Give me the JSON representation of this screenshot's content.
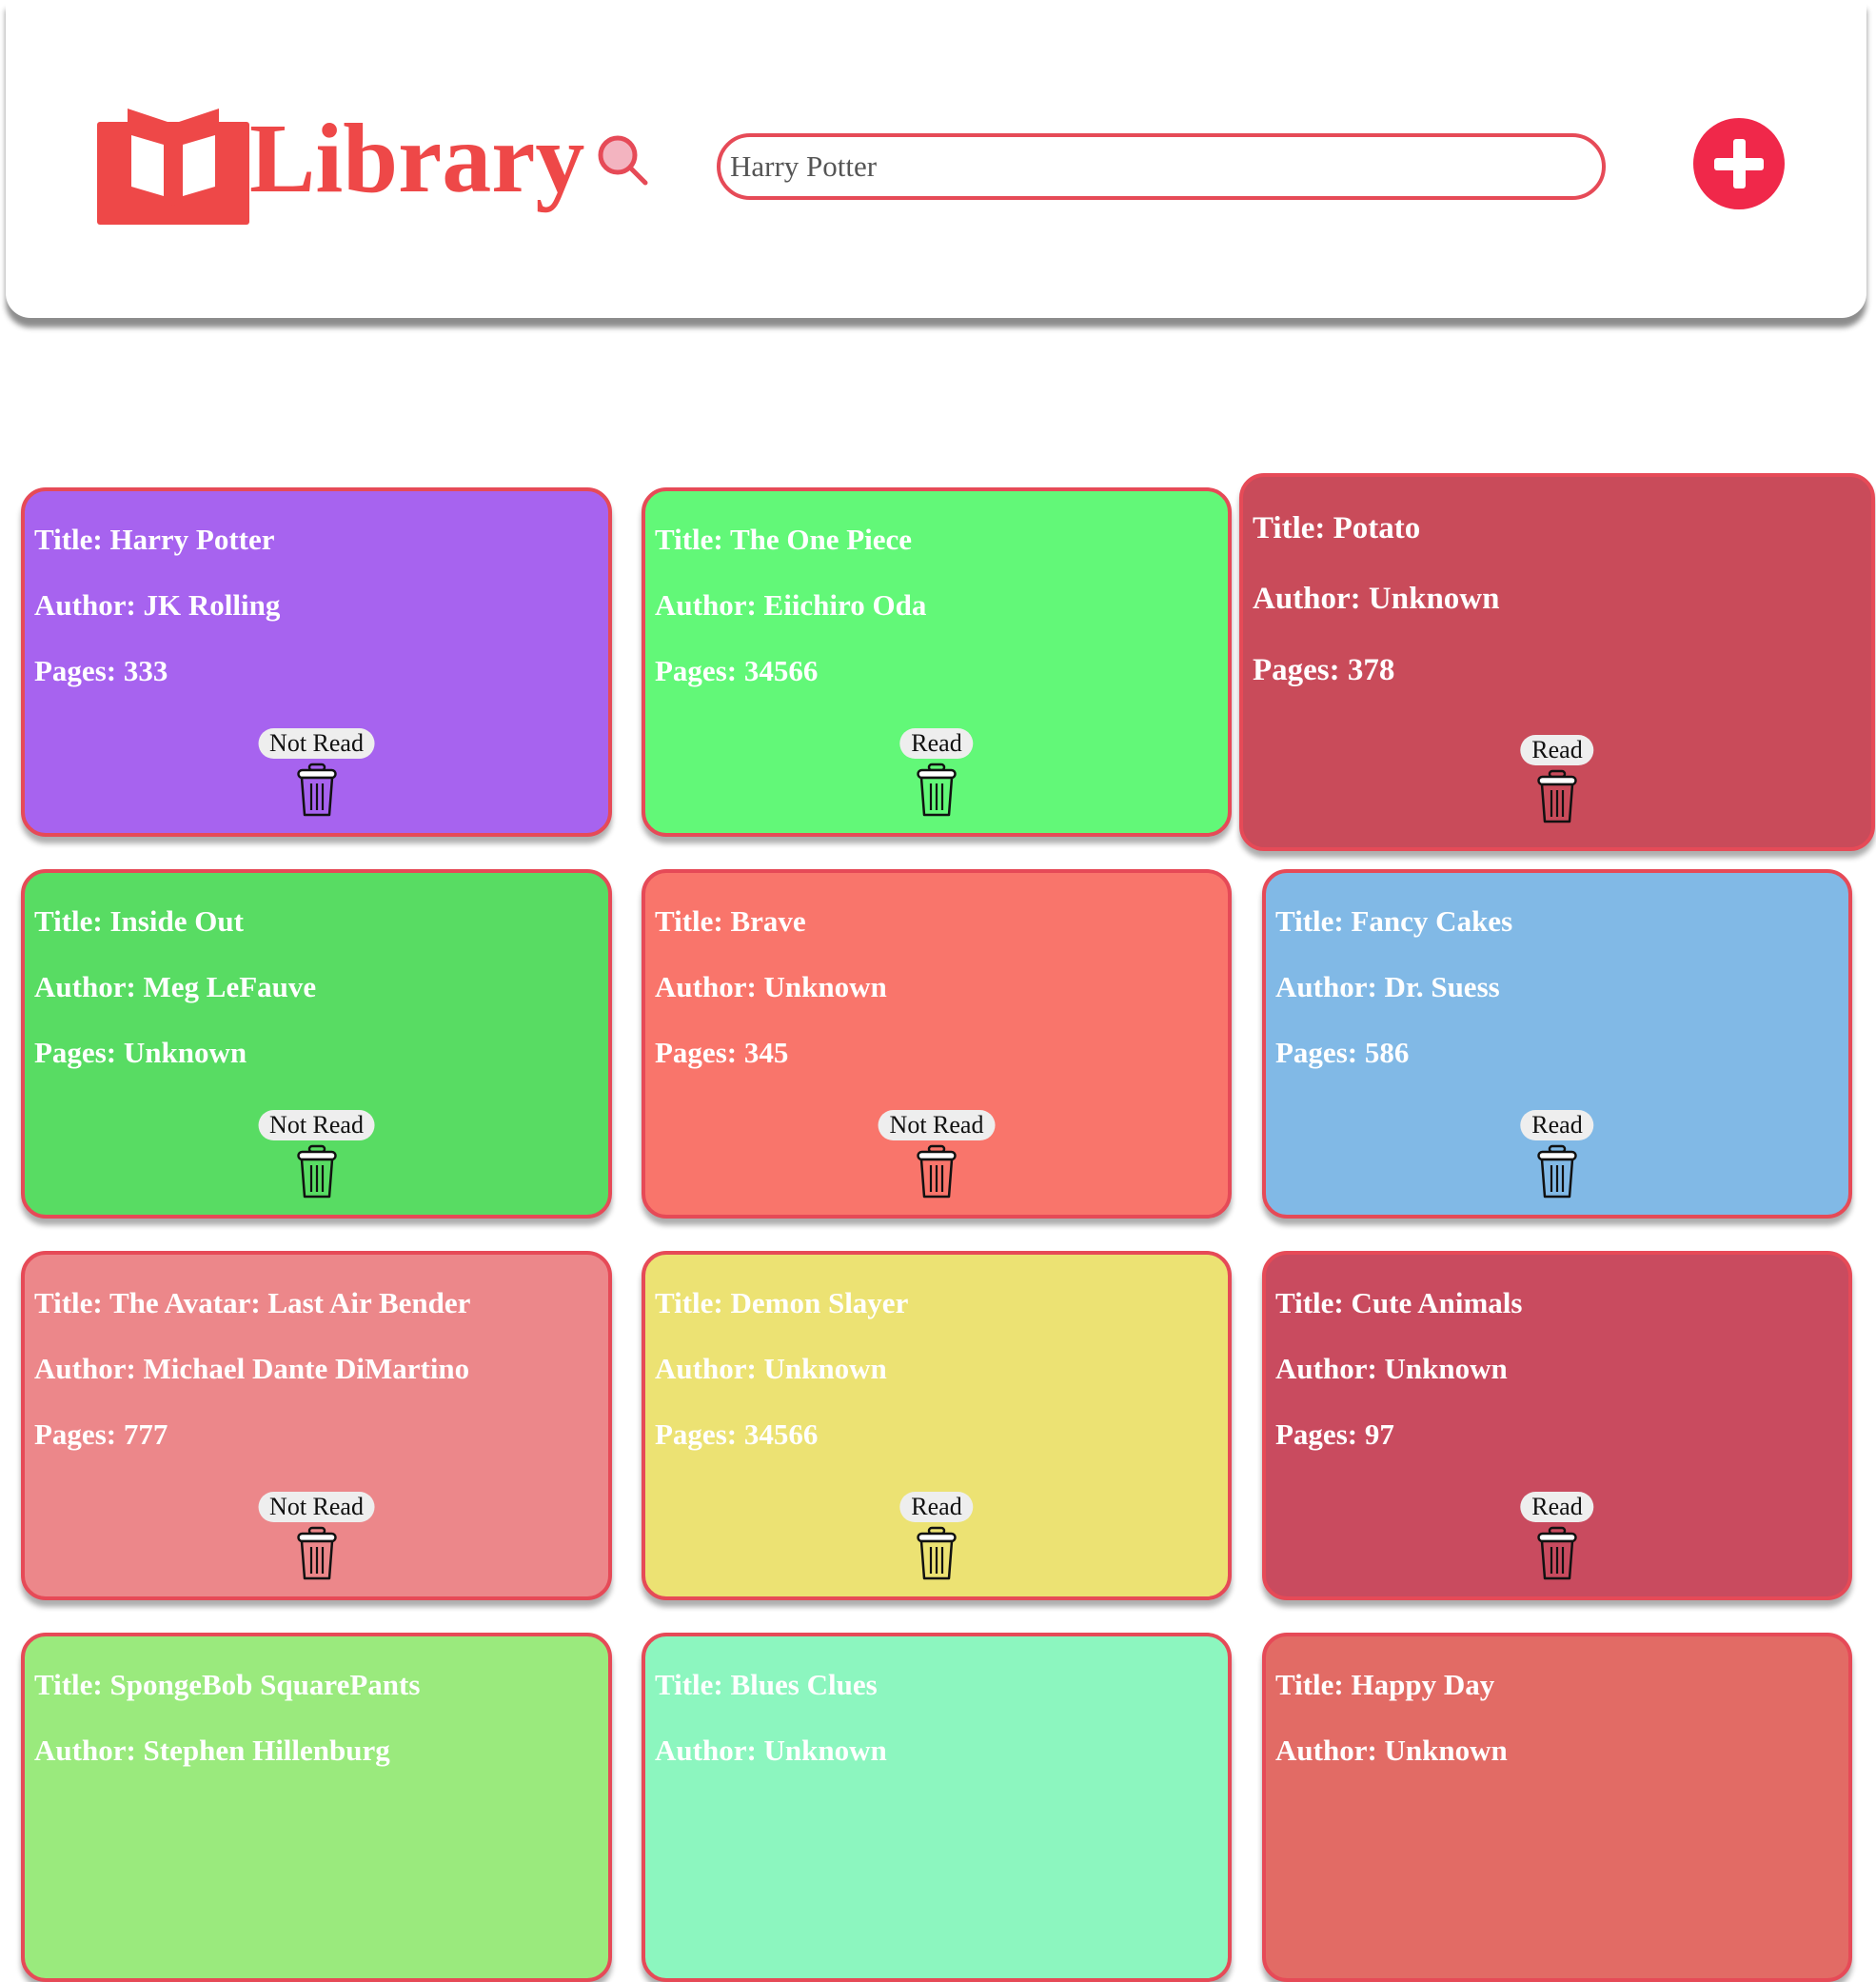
{
  "header": {
    "logo_text": "Library",
    "search_value": "Harry Potter"
  },
  "books": [
    {
      "title": "Title: Harry Potter",
      "author": "Author: JK Rolling",
      "pages": "Pages: 333",
      "status": "Not Read",
      "color": "#a763ef"
    },
    {
      "title": "Title: The One Piece",
      "author": "Author: Eiichiro Oda",
      "pages": "Pages: 34566",
      "status": "Read",
      "color": "#62f878"
    },
    {
      "title": "Title: Potato",
      "author": "Author: Unknown",
      "pages": "Pages: 378",
      "status": "Read",
      "color": "#c94b5a"
    },
    {
      "title": "Title: Inside Out",
      "author": "Author: Meg LeFauve",
      "pages": "Pages: Unknown",
      "status": "Not Read",
      "color": "#58dc63"
    },
    {
      "title": "Title: Brave",
      "author": "Author: Unknown",
      "pages": "Pages: 345",
      "status": "Not Read",
      "color": "#f9756b"
    },
    {
      "title": "Title: Fancy Cakes",
      "author": "Author: Dr. Suess",
      "pages": "Pages: 586",
      "status": "Read",
      "color": "#81b9e6"
    },
    {
      "title": "Title: The Avatar: Last Air Bender",
      "author": "Author: Michael Dante DiMartino",
      "pages": "Pages: 777",
      "status": "Not Read",
      "color": "#ec878a"
    },
    {
      "title": "Title: Demon Slayer",
      "author": "Author: Unknown",
      "pages": "Pages: 34566",
      "status": "Read",
      "color": "#ece273"
    },
    {
      "title": "Title: Cute Animals",
      "author": "Author: Unknown",
      "pages": "Pages: 97",
      "status": "Read",
      "color": "#c94b5f"
    },
    {
      "title": "Title: SpongeBob SquarePants",
      "author": "Author: Stephen Hillenburg",
      "pages": "",
      "status": "",
      "color": "#9aea7d"
    },
    {
      "title": "Title: Blues Clues",
      "author": "Author: Unknown",
      "pages": "",
      "status": "",
      "color": "#8cf6bf"
    },
    {
      "title": "Title: Happy Day",
      "author": "Author: Unknown",
      "pages": "",
      "status": "",
      "color": "#e26b65"
    }
  ]
}
